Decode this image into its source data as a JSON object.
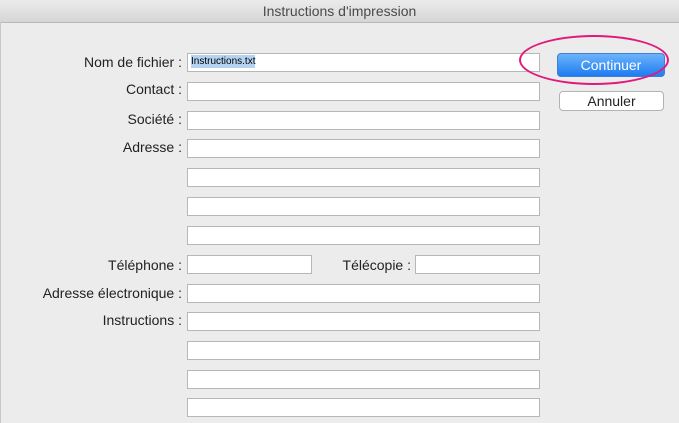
{
  "window": {
    "title": "Instructions d'impression"
  },
  "form": {
    "filename": {
      "label": "Nom de fichier :",
      "value": "Instructions.txt"
    },
    "contact": {
      "label": "Contact :",
      "value": ""
    },
    "company": {
      "label": "Société :",
      "value": ""
    },
    "address": {
      "label": "Adresse :",
      "lines": [
        "",
        "",
        "",
        ""
      ]
    },
    "phone": {
      "label": "Téléphone :",
      "value": ""
    },
    "fax": {
      "label": "Télécopie :",
      "value": ""
    },
    "email": {
      "label": "Adresse électronique :",
      "value": ""
    },
    "instructions": {
      "label": "Instructions :",
      "lines": [
        "",
        "",
        "",
        ""
      ]
    }
  },
  "buttons": {
    "continue": "Continuer",
    "cancel": "Annuler"
  },
  "colors": {
    "accent": "#1e7cf2",
    "highlight_ring": "#e0197d"
  }
}
